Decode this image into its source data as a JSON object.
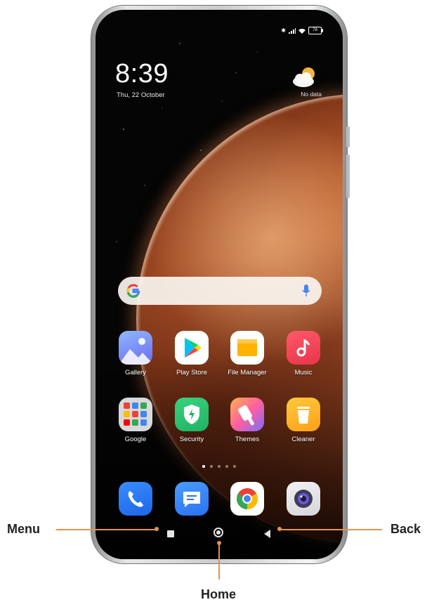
{
  "status_bar": {
    "battery": "78"
  },
  "lockscreen": {
    "time": "8:39",
    "date": "Thu, 22 October",
    "weather": "No data"
  },
  "search": {
    "assistant": "Google search bar"
  },
  "apps_row1": [
    {
      "label": "Gallery"
    },
    {
      "label": "Play Store"
    },
    {
      "label": "File Manager"
    },
    {
      "label": "Music"
    }
  ],
  "apps_row2": [
    {
      "label": "Google"
    },
    {
      "label": "Security"
    },
    {
      "label": "Themes"
    },
    {
      "label": "Cleaner"
    }
  ],
  "dock": [
    {
      "icon": "phone-icon"
    },
    {
      "icon": "messages-icon"
    },
    {
      "icon": "chrome-icon"
    },
    {
      "icon": "camera-icon"
    }
  ],
  "page_indicator": {
    "pages": 5,
    "active": 1
  },
  "callouts": {
    "menu": "Menu",
    "home": "Home",
    "back": "Back"
  },
  "colors": {
    "callout": "#e8924a",
    "search_bg": "#f7f2ee"
  }
}
